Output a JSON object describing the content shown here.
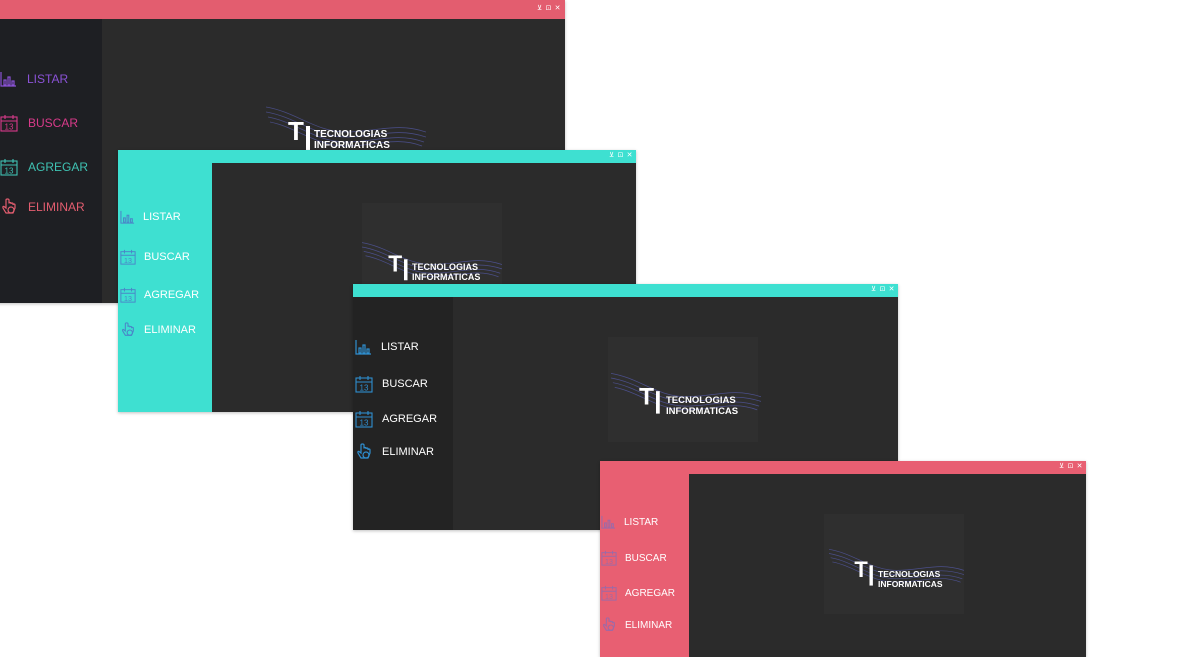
{
  "logo": {
    "line1": "TECNOLOGIAS",
    "line2": "INFORMATICAS",
    "mark": "TI"
  },
  "window_controls": {
    "minimize": "⊻",
    "maximize": "⊡",
    "close": "✕"
  },
  "menu": [
    {
      "label": "LISTAR",
      "icon": "bar-chart-icon"
    },
    {
      "label": "BUSCAR",
      "icon": "calendar-icon"
    },
    {
      "label": "AGREGAR",
      "icon": "calendar-icon"
    },
    {
      "label": "ELIMINAR",
      "icon": "hand-pointer-icon"
    }
  ],
  "themes": {
    "dark_multicolor": {
      "titlebar": "#e35d6f",
      "sidebar": "#1e1f23",
      "colors": [
        "#8a52d6",
        "#d93a8a",
        "#3fc2b3",
        "#e35d6f"
      ]
    },
    "turquoise": {
      "titlebar": "#3ee0d1",
      "sidebar": "#3ee0d1",
      "text": "#ffffff",
      "icon": "#4a86c8"
    },
    "dark_turquoise": {
      "titlebar": "#3ee0d1",
      "sidebar": "#232323",
      "text": "#ffffff",
      "icon": "#2f8fd0"
    },
    "coral": {
      "titlebar": "#e85f72",
      "sidebar": "#e85f72",
      "text": "#ffffff",
      "icon": "#9b6aa8"
    }
  }
}
